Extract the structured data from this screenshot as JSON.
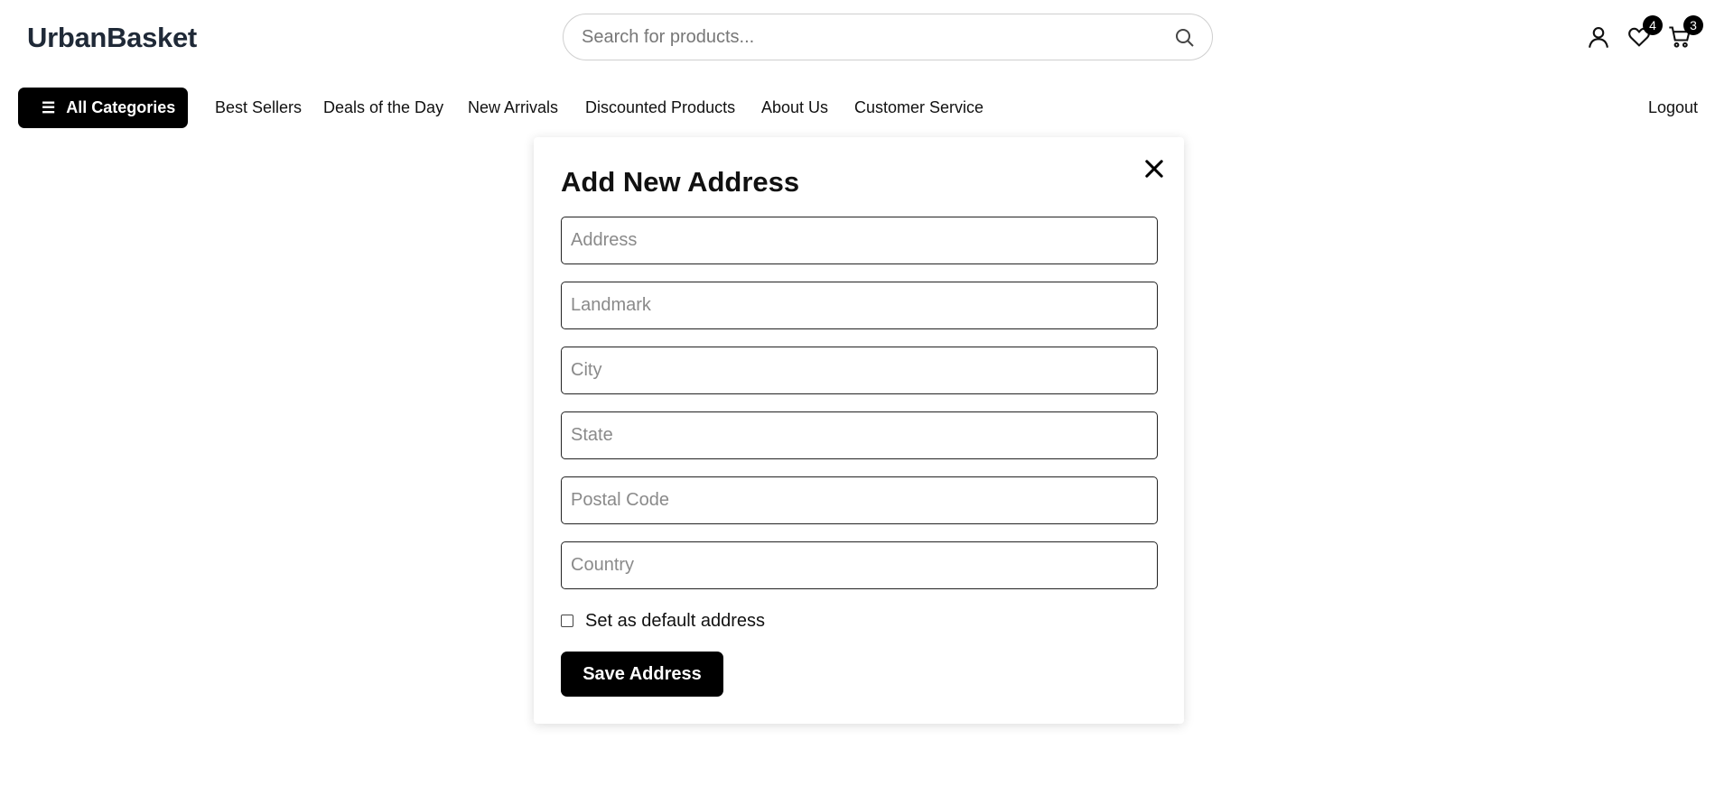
{
  "header": {
    "logo": "UrbanBasket",
    "search_placeholder": "Search for products...",
    "icons": [
      "search-icon",
      "user-icon",
      "heart-icon",
      "cart-icon"
    ],
    "wishlist_count": "4",
    "cart_count": "3"
  },
  "nav": {
    "all_categories": "All Categories",
    "links": [
      "Best Sellers",
      "Deals of the Day",
      "New Arrivals",
      "Discounted Products",
      "About Us",
      "Customer Service"
    ],
    "logout": "Logout"
  },
  "modal": {
    "title": "Add New Address",
    "fields": {
      "address": "Address",
      "landmark": "Landmark",
      "city": "City",
      "state": "State",
      "postal_code": "Postal Code",
      "country": "Country"
    },
    "default_checkbox_label": "Set as default address",
    "default_checked": false,
    "save_label": "Save Address"
  },
  "colors": {
    "primary": "#000000",
    "logo": "#1f2937",
    "background": "#ffffff"
  }
}
